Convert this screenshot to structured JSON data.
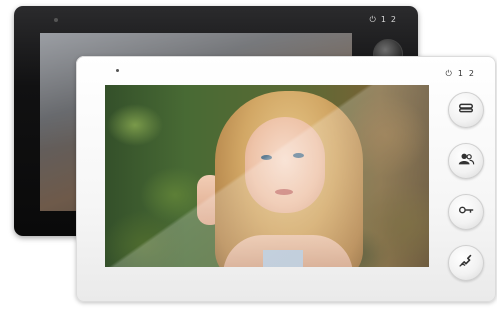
{
  "back_monitor": {
    "indicators": [
      "⏻",
      "1",
      "2"
    ],
    "color": "#111112"
  },
  "front_monitor": {
    "indicators": [
      "⏻",
      "1",
      "2"
    ],
    "color": "#ffffff"
  },
  "side_buttons": [
    {
      "icon": "phone-handset-icon"
    },
    {
      "icon": "users-icon"
    },
    {
      "icon": "key-icon"
    },
    {
      "icon": "hangup-icon"
    }
  ]
}
